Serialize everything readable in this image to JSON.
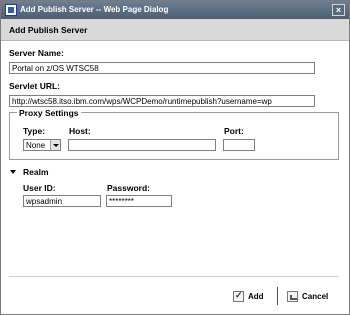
{
  "window": {
    "title": "Add Publish Server -- Web Page Dialog",
    "close_glyph": "×"
  },
  "header": {
    "heading": "Add Publish Server"
  },
  "form": {
    "server_name_label": "Server Name:",
    "server_name_value": "Portal on z/OS WTSC58",
    "servlet_url_label": "Servlet URL:",
    "servlet_url_value": "http://wtsc58.itso.ibm.com/wps/WCPDemo/runtimepublish?username=wp"
  },
  "proxy": {
    "legend": "Proxy Settings",
    "type_label": "Type:",
    "type_value": "None",
    "host_label": "Host:",
    "host_value": "",
    "port_label": "Port:",
    "port_value": ""
  },
  "realm": {
    "section_label": "Realm",
    "user_id_label": "User ID:",
    "user_id_value": "wpsadmin",
    "password_label": "Password:",
    "password_value": "********"
  },
  "buttons": {
    "add_label": "Add",
    "cancel_label": "Cancel"
  }
}
